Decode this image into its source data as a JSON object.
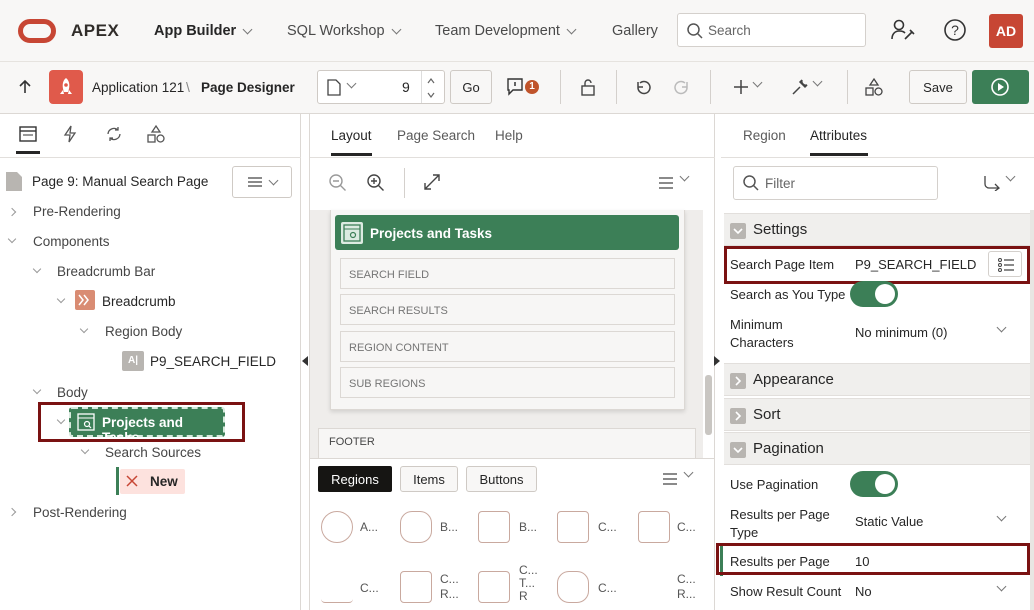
{
  "topbar": {
    "brand": "APEX",
    "nav": [
      "App Builder",
      "SQL Workshop",
      "Team Development",
      "Gallery"
    ],
    "search_placeholder": "Search",
    "avatar": "AD"
  },
  "toolbar": {
    "breadcrumb_app": "Application 121",
    "breadcrumb_sep": "\\",
    "breadcrumb_page": "Page Designer",
    "page_number": "9",
    "go_label": "Go",
    "messages_count": "1",
    "save_label": "Save"
  },
  "left": {
    "page_title": "Page 9: Manual Search Page",
    "tree": {
      "pre_rendering": "Pre-Rendering",
      "components": "Components",
      "breadcrumb_bar": "Breadcrumb Bar",
      "breadcrumb": "Breadcrumb",
      "region_body": "Region Body",
      "search_field": "P9_SEARCH_FIELD",
      "body": "Body",
      "projects_tasks": "Projects and Tasks",
      "search_sources": "Search Sources",
      "new": "New",
      "post_rendering": "Post-Rendering"
    }
  },
  "middle": {
    "tabs": [
      "Layout",
      "Page Search",
      "Help"
    ],
    "region_title": "Projects and Tasks",
    "slots": [
      "SEARCH FIELD",
      "SEARCH RESULTS",
      "REGION CONTENT",
      "SUB REGIONS"
    ],
    "footer": "FOOTER",
    "gallery_tabs": [
      "Regions",
      "Items",
      "Buttons"
    ],
    "gallery_row1": [
      "A...",
      "B...",
      "B...",
      "C...",
      "C..."
    ],
    "gallery_row2": [
      "C...",
      "C...\nR...",
      "C...\nT...\nR",
      "C...",
      "C...\nR..."
    ]
  },
  "right": {
    "tabs": [
      "Region",
      "Attributes"
    ],
    "filter_placeholder": "Filter",
    "sections": {
      "settings": "Settings",
      "appearance": "Appearance",
      "sort": "Sort",
      "pagination": "Pagination"
    },
    "props": {
      "search_page_item_label": "Search Page Item",
      "search_page_item_value": "P9_SEARCH_FIELD",
      "search_as_you_type_label": "Search as You Type",
      "minimum_chars_label": "Minimum Characters",
      "minimum_chars_value": "No minimum (0)",
      "use_pagination_label": "Use Pagination",
      "results_per_page_type_label": "Results per Page Type",
      "results_per_page_type_value": "Static Value",
      "results_per_page_label": "Results per Page",
      "results_per_page_value": "10",
      "show_result_count_label": "Show Result Count",
      "show_result_count_value": "No"
    }
  },
  "colors": {
    "accent": "#c74634",
    "green": "#3c7f57",
    "highlight": "#7a1212"
  }
}
